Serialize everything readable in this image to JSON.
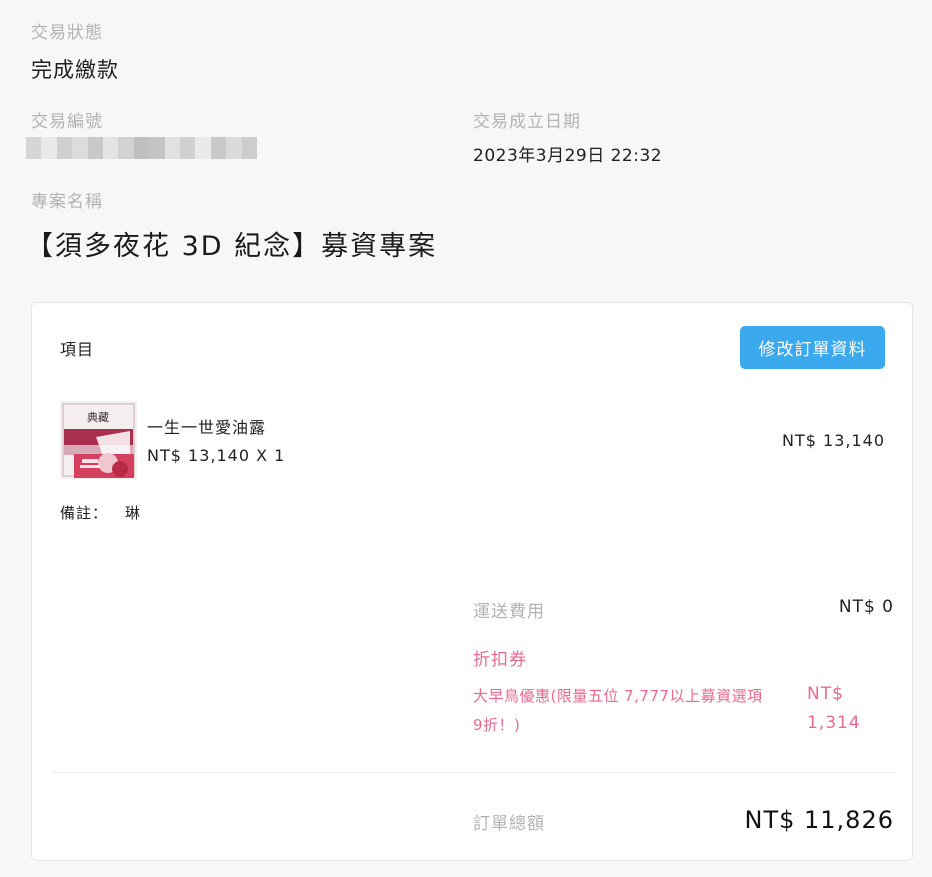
{
  "status": {
    "label": "交易狀態",
    "value": "完成繳款"
  },
  "transaction": {
    "id_label": "交易編號",
    "date_label": "交易成立日期",
    "date_value": "2023年3月29日 22:32"
  },
  "project": {
    "label": "專案名稱",
    "name": "【須多夜花 3D 紀念】募資專案"
  },
  "order": {
    "items_header": "項目",
    "edit_button_label": "修改訂單資料",
    "item": {
      "name": "一生一世愛油露",
      "price_qty": "NT$ 13,140 X 1",
      "subtotal": "NT$ 13,140",
      "thumbnail_text": "典藏"
    },
    "note_label": "備註：",
    "note_value": "琳",
    "shipping_label": "運送費用",
    "shipping_value": "NT$ 0",
    "coupon_label": "折扣券",
    "coupon_name_line1": "大早鳥優惠(限量五位 7,777以上募資選項",
    "coupon_name_line2": "9折！)",
    "coupon_value_line1": "NT$",
    "coupon_value_line2": "1,314",
    "total_label": "訂單總額",
    "total_value": "NT$ 11,826"
  },
  "colors": {
    "accent": "#3aa9ee",
    "discount": "#ea6a8e",
    "label": "#b3b3b3"
  }
}
